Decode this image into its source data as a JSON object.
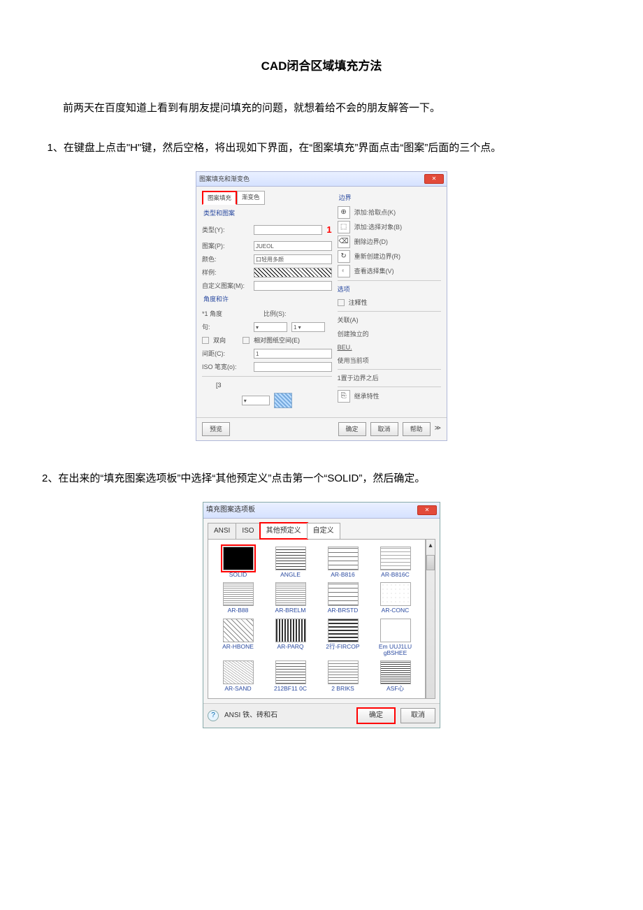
{
  "title": "CAD闭合区域填充方法",
  "intro": "前两天在百度知道上看到有朋友提问填充的问题，就想着给不会的朋友解答一下。",
  "step1": "1、在键盘上点击\"H\"键，然后空格，将出现如下界面，在“图案填充”界面点击“图案”后面的三个点。",
  "step2": "2、在出来的“填充图案选项板”中选择“其他预定义”点击第一个“SOLID”，然后确定。",
  "dialog1": {
    "title": "图案填充和渐变色",
    "tabs": [
      "图案填充",
      "渐变色"
    ],
    "group_type": "类型和图案",
    "lbl_type": "类型(Y):",
    "lbl_pattern": "图案(P):",
    "val_pattern": "JUEOL",
    "lbl_color": "颜色:",
    "val_color": "口轻用多颜",
    "lbl_sample": "样例:",
    "lbl_custom": "自定义图案(M):",
    "marker": "1",
    "group_angle": "角度和许",
    "lbl_angle": "*1 角度",
    "lbl_sentence": "句:",
    "lbl_scale": "比例(S):",
    "chk_double": "双向",
    "chk_relative": "相对图纸空间(E)",
    "lbl_spacing": "间距(C):",
    "lbl_iso": "ISO 笔宽(o):",
    "origin_marker": "[3",
    "right_title": "边界",
    "r1": "添加:拾取点(K)",
    "r2": "添加:选择对象(B)",
    "r3": "删除边界(D)",
    "r4": "重新创建边界(R)",
    "r5": "查看选择集(V)",
    "chk_annotative": "注释性",
    "opt1": "关联(A)",
    "opt2": "创建独立的",
    "opt3": "BEU.",
    "opt4": "使用当前项",
    "opt5": "1置于边界之后",
    "opt6": "继承特性",
    "btn_preview": "预览",
    "btn_ok": "确定",
    "btn_cancel": "取消",
    "btn_help": "帮助"
  },
  "dialog2": {
    "title": "填充图案选项板",
    "tabs": [
      "ANSI",
      "ISO",
      "其他预定义",
      "自定义"
    ],
    "patterns": [
      {
        "name": "SOLID",
        "cls": "solid"
      },
      {
        "name": "ANGLE",
        "cls": "hatch1"
      },
      {
        "name": "AR-B816",
        "cls": "brick"
      },
      {
        "name": "AR-B816C",
        "cls": "brick2"
      },
      {
        "name": "AR-B88",
        "cls": "dots"
      },
      {
        "name": "AR-BRELM",
        "cls": "dots"
      },
      {
        "name": "AR-BRSTD",
        "cls": "brick"
      },
      {
        "name": "AR-CONC",
        "cls": "scribble"
      },
      {
        "name": "AR-HBONE",
        "cls": "cross"
      },
      {
        "name": "AR-PARQ",
        "cls": "stripes"
      },
      {
        "name": "2行-FIRCOP",
        "cls": "bars"
      },
      {
        "name": "Em UUJ1LU gBSHEE",
        "cls": "none"
      },
      {
        "name": "AR-SAND",
        "cls": "sand"
      },
      {
        "name": "212BF11 0C",
        "cls": "grid"
      },
      {
        "name": "2 BRIKS",
        "cls": "waves"
      },
      {
        "name": "ASF心",
        "cls": "lines"
      }
    ],
    "footer_text": "ANSI 铁、砖和石",
    "btn_ok": "确定",
    "btn_cancel": "取消"
  }
}
